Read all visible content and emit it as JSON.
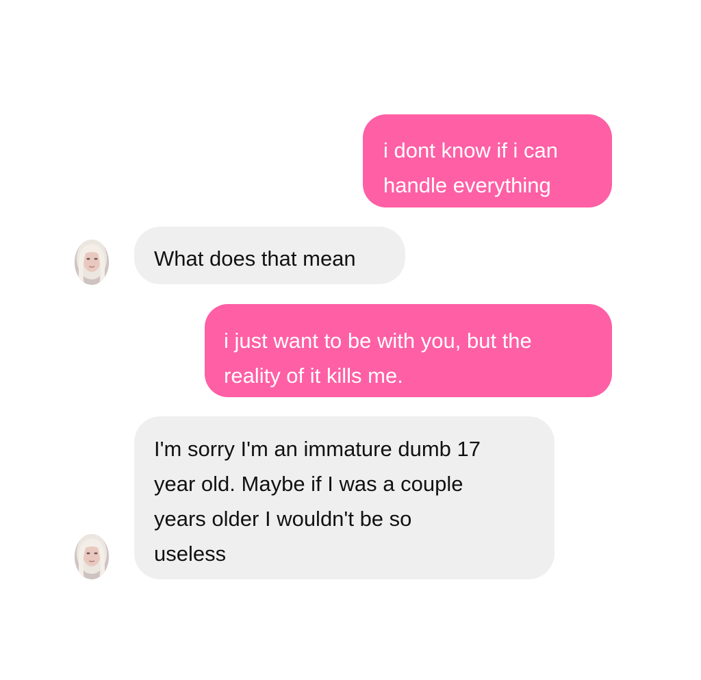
{
  "conversation": {
    "messages": [
      {
        "direction": "outgoing",
        "text": "i dont know if i can\nhandle everything"
      },
      {
        "direction": "incoming",
        "text": "What does that mean"
      },
      {
        "direction": "outgoing",
        "text": "i just want to be with you, but the\nreality of it kills me."
      },
      {
        "direction": "incoming",
        "text": "I'm sorry I'm an immature dumb 17\nyear old. Maybe if I was a couple\nyears older I wouldn't be so\nuseless"
      }
    ]
  },
  "colors": {
    "outgoing_bubble": "#fe5fa5",
    "incoming_bubble": "#efefef",
    "outgoing_text": "#ffffff",
    "incoming_text": "#111111"
  },
  "icons": {
    "avatar": "contact-avatar-photo"
  }
}
